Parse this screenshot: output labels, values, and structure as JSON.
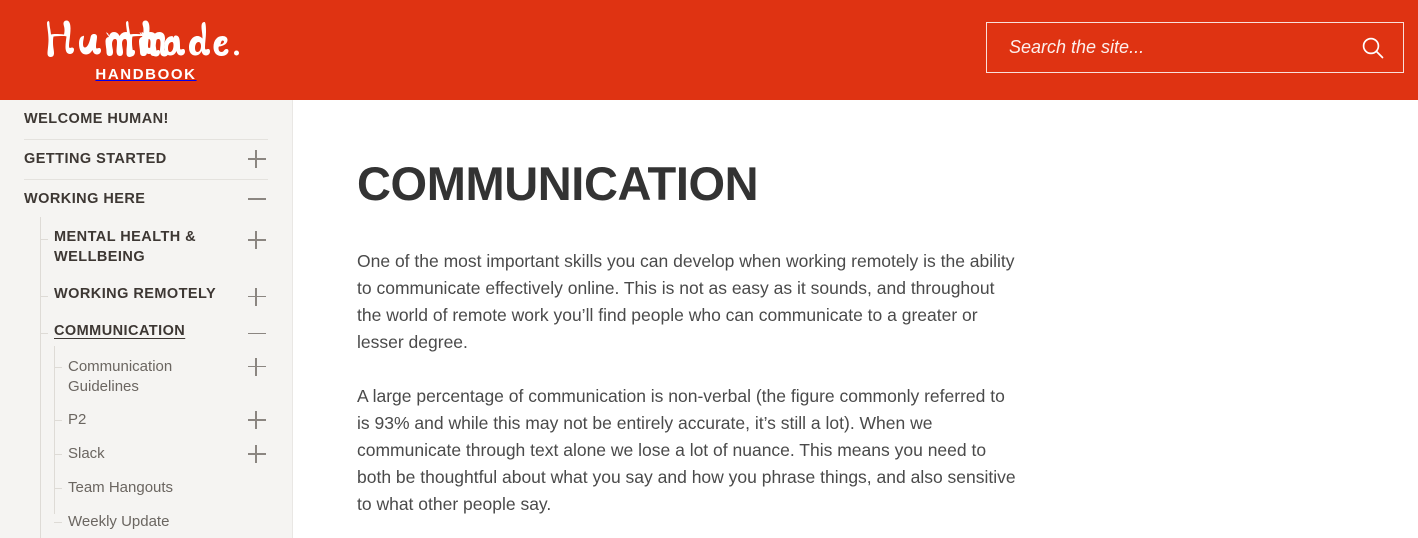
{
  "header": {
    "brand_name": "Human Made",
    "brand_sub": "HANDBOOK",
    "bg_color": "#df3312",
    "search": {
      "placeholder": "Search the site...",
      "value": "",
      "icon": "search-icon"
    }
  },
  "sidebar": {
    "bg_color": "#f5f4f2",
    "items": [
      {
        "label": "Welcome Human!",
        "toggle": null,
        "active": false
      },
      {
        "label": "Getting Started",
        "toggle": "+",
        "active": false
      },
      {
        "label": "Working Here",
        "toggle": "−",
        "active": false,
        "children": [
          {
            "label": "Mental Health & Wellbeing",
            "toggle": "+",
            "active": false
          },
          {
            "label": "Working Remotely",
            "toggle": "+",
            "active": false
          },
          {
            "label": "Communication",
            "toggle": "−",
            "active": true,
            "children": [
              {
                "label": "Communication Guidelines",
                "toggle": "+"
              },
              {
                "label": "P2",
                "toggle": "+"
              },
              {
                "label": "Slack",
                "toggle": "+"
              },
              {
                "label": "Team Hangouts",
                "toggle": null
              },
              {
                "label": "Weekly Update",
                "toggle": null
              }
            ]
          }
        ]
      }
    ]
  },
  "main": {
    "title": "Communication",
    "paragraphs": [
      "One of the most important skills you can develop when working remotely is the ability to communicate effectively online. This is not as easy as it sounds, and throughout the world of remote work you’ll find people who can communicate to a greater or lesser degree.",
      "A large percentage of communication is non-verbal (the figure commonly referred to is 93% and while this may not be entirely accurate, it’s still a lot). When we communicate through text alone we lose a lot of nuance. This means you need to both be thoughtful about what you say and how you phrase things, and also sensitive to what other people say."
    ]
  }
}
